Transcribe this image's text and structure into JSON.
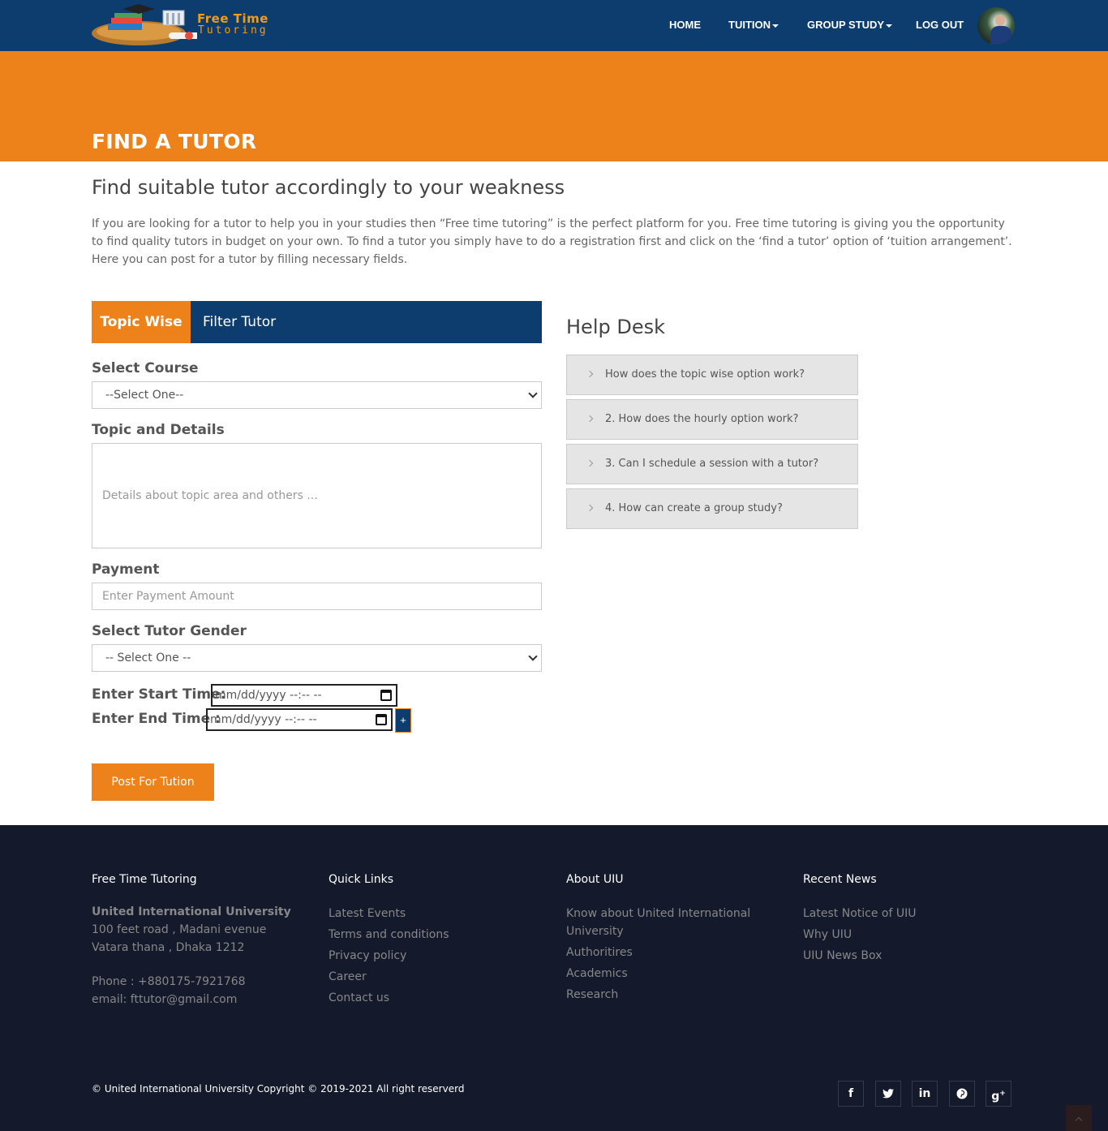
{
  "header": {
    "logo_title": "Free Time",
    "logo_subtitle": "Tutoring",
    "nav": {
      "home": "HOME",
      "tuition": "TUITION",
      "group_study": "GROUP STUDY",
      "logout": "LOG OUT"
    },
    "colors": {
      "bar": "#0d3d6e",
      "accent": "#ee821a"
    }
  },
  "banner": {
    "title": "FIND A TUTOR"
  },
  "intro": {
    "heading": "Find suitable tutor accordingly to your weakness",
    "body": "If you are looking for a tutor to help you in your studies then “Free time tutoring” is the perfect platform for you. Free time tutoring is giving you the opportunity to find quality tutors in budget on your own. To find a tutor you simply have to do a registration first and click on the ‘find a tutor’ option of ‘tuition arrangement’. Here you can post for a tutor by filling necessary fields."
  },
  "tabs": {
    "active": "Topic Wise",
    "other": "Filter Tutor"
  },
  "form": {
    "course_label": "Select Course",
    "course_value": "--Select One--",
    "topic_label": "Topic and Details",
    "topic_placeholder": "Details about topic area and others ...",
    "payment_label": "Payment",
    "payment_placeholder": "Enter Payment Amount",
    "gender_label": "Select Tutor Gender",
    "gender_value": "-- Select One --",
    "start_label": "Enter Start Time:",
    "start_value": "mm/dd/yyyy --:-- --",
    "end_label": "Enter End Time :",
    "end_value": "mm/dd/yyyy --:-- --",
    "plus_label": "+",
    "submit_label": "Post For Tution"
  },
  "help": {
    "title": "Help Desk",
    "items": [
      "How does the topic wise option work?",
      "2. How does the hourly option work?",
      "3. Can I schedule a session with a tutor?",
      "4. How can create a group study?"
    ]
  },
  "footer": {
    "col1": {
      "heading": "Free Time Tutoring",
      "org": "United International University",
      "address1": "100 feet road , Madani evenue",
      "address2": "Vatara thana , Dhaka 1212",
      "phone": "Phone : +880175-7921768",
      "email": "email: fttutor@gmail.com"
    },
    "col2": {
      "heading": "Quick Links",
      "links": [
        "Latest Events",
        "Terms and conditions",
        "Privacy policy",
        "Career",
        "Contact us"
      ]
    },
    "col3": {
      "heading": "About UIU",
      "links": [
        "Know about United International University",
        "Authoritires",
        "Academics",
        "Research"
      ]
    },
    "col4": {
      "heading": "Recent News",
      "links": [
        "Latest Notice of UIU",
        "Why UIU",
        "UIU News Box"
      ]
    },
    "copyright": "© United International University Copyright © 2019-2021 All right reserverd",
    "social": [
      "facebook-icon",
      "twitter-icon",
      "linkedin-icon",
      "pinterest-icon",
      "google-plus-icon"
    ]
  }
}
